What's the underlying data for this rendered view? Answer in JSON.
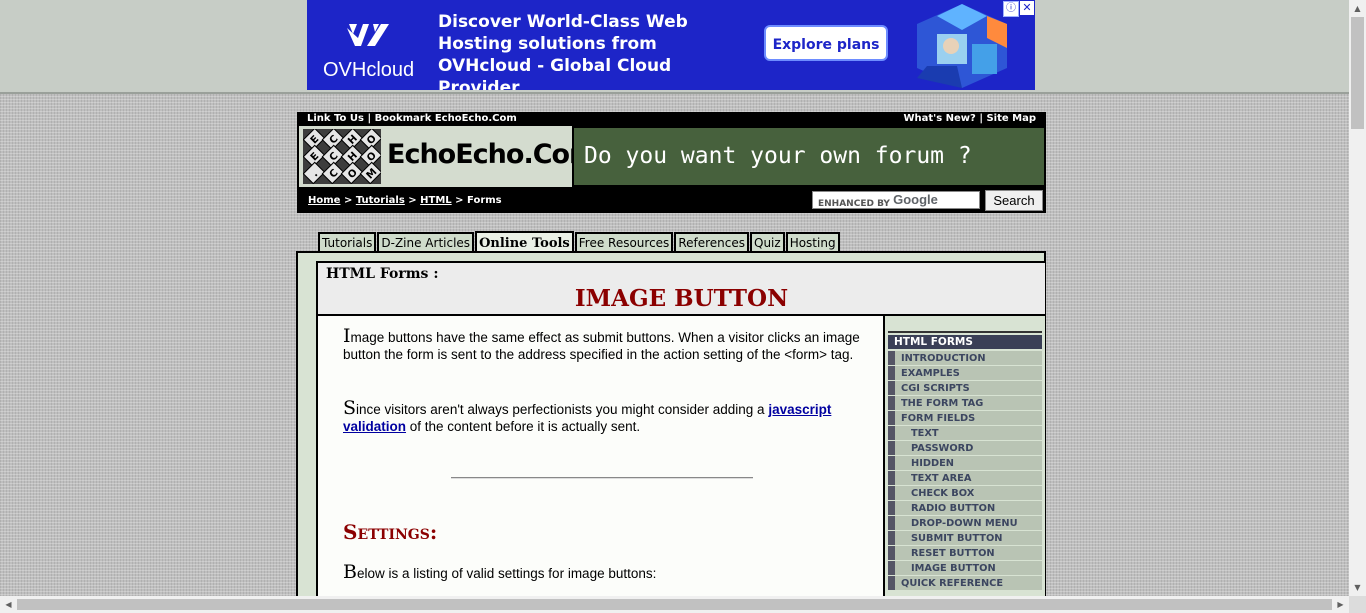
{
  "ad": {
    "brand": "OVHcloud",
    "headline": "Discover World-Class Web Hosting solutions from OVHcloud - Global Cloud Provider",
    "cta": "Explore plans",
    "badge": "ⓘ",
    "close": "✕"
  },
  "header": {
    "top_left": [
      "Link To Us",
      "Bookmark EchoEcho.Com"
    ],
    "top_right": [
      "What's New?",
      "Site Map"
    ],
    "logo_text": "EchoEcho.Com",
    "logo_tiles": [
      "E",
      "C",
      "H",
      "O",
      "E",
      "C",
      "H",
      "O",
      ".",
      "C",
      "O",
      "M"
    ],
    "banner_text": "Do you want your own forum ?"
  },
  "breadcrumb": {
    "links": [
      "Home",
      "Tutorials",
      "HTML"
    ],
    "current": "Forms",
    "separator": ">"
  },
  "search": {
    "placeholder_prefix": "ENHANCED BY",
    "placeholder_brand": "Google",
    "button": "Search"
  },
  "tabs": [
    {
      "label": "Tutorials",
      "active": false
    },
    {
      "label": "D-Zine Articles",
      "active": false
    },
    {
      "label": "Online Tools",
      "active": true
    },
    {
      "label": "Free Resources",
      "active": false
    },
    {
      "label": "References",
      "active": false
    },
    {
      "label": "Quiz",
      "active": false
    },
    {
      "label": "Hosting",
      "active": false
    }
  ],
  "page": {
    "section": "HTML Forms :",
    "title": "IMAGE BUTTON"
  },
  "content": {
    "p1": {
      "dropcap": "I",
      "text": "mage buttons have the same effect as submit buttons. When a visitor clicks an image button the form is sent to the address specified in the action setting of the <form> tag."
    },
    "p2": {
      "dropcap": "S",
      "before": "ince visitors aren't always perfectionists you might consider adding a ",
      "link": "javascript validation",
      "after": " of the content before it is actually sent."
    },
    "settings_heading": "Settings:",
    "p3": {
      "dropcap": "B",
      "text": "elow is a listing of valid settings for image buttons:"
    }
  },
  "sidebar": {
    "heading": "HTML FORMS",
    "items": [
      {
        "label": "INTRODUCTION",
        "sub": false
      },
      {
        "label": "EXAMPLES",
        "sub": false
      },
      {
        "label": "CGI SCRIPTS",
        "sub": false
      },
      {
        "label": "THE FORM TAG",
        "sub": false
      },
      {
        "label": "FORM FIELDS",
        "sub": false
      },
      {
        "label": "TEXT",
        "sub": true
      },
      {
        "label": "PASSWORD",
        "sub": true
      },
      {
        "label": "HIDDEN",
        "sub": true
      },
      {
        "label": "TEXT AREA",
        "sub": true
      },
      {
        "label": "CHECK BOX",
        "sub": true
      },
      {
        "label": "RADIO BUTTON",
        "sub": true
      },
      {
        "label": "DROP-DOWN MENU",
        "sub": true
      },
      {
        "label": "SUBMIT BUTTON",
        "sub": true
      },
      {
        "label": "RESET BUTTON",
        "sub": true
      },
      {
        "label": "IMAGE BUTTON",
        "sub": true
      },
      {
        "label": "QUICK REFERENCE",
        "sub": false
      }
    ]
  },
  "colors": {
    "ad_bg": "#1d25c8",
    "title_red": "#8b0000",
    "banner_green": "#47613d",
    "sidebar_head": "#3a3f56",
    "link_blue": "#0000a0"
  }
}
